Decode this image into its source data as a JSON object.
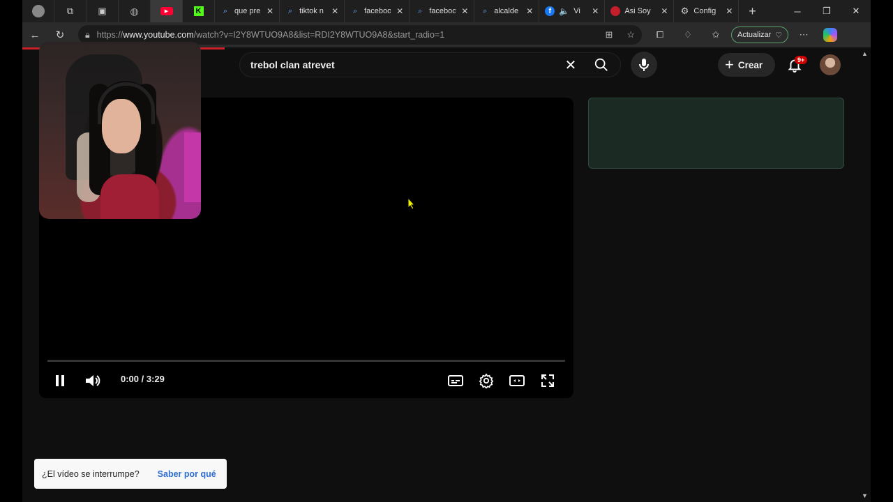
{
  "browser": {
    "tabs": [
      {
        "title": "",
        "icon": "profile-avatar-icon",
        "pinned": true
      },
      {
        "title": "",
        "icon": "workspaces-icon",
        "pinned": true
      },
      {
        "title": "",
        "icon": "tab-actions-icon",
        "pinned": true
      },
      {
        "title": "",
        "icon": "globe-icon",
        "pinned": true
      },
      {
        "title": "",
        "icon": "youtube-icon",
        "pinned": true,
        "active": true
      },
      {
        "title": "",
        "icon": "kick-icon",
        "pinned": true
      },
      {
        "title": "que pre",
        "icon": "search-icon"
      },
      {
        "title": "tiktok n",
        "icon": "search-icon"
      },
      {
        "title": "faceboo",
        "icon": "search-icon"
      },
      {
        "title": "faceboo",
        "icon": "search-icon"
      },
      {
        "title": "alcalde",
        "icon": "search-icon"
      },
      {
        "title": "Vi",
        "icon": "facebook-icon"
      },
      {
        "title": "Asi Soy",
        "icon": "red-favicon-icon"
      },
      {
        "title": "Config",
        "icon": "gear-icon"
      }
    ],
    "new_tab_symbol": "+",
    "address": {
      "prefix": "https://",
      "host": "www.youtube.com",
      "path": "/watch?v=I2Y8WTUO9A8&list=RDI2Y8WTUO9A8&start_radio=1"
    },
    "update_label": "Actualizar"
  },
  "youtube": {
    "search_query": "trebol clan atrevet",
    "create_label": "Crear",
    "notification_badge": "9+",
    "player": {
      "time_label": "0:00 / 3:29",
      "progress": 0.0
    },
    "toast": {
      "text": "¿El vídeo se interrumpe?",
      "link": "Saber por qué"
    }
  },
  "colors": {
    "accent_red": "#ff0033",
    "update_border": "#5aa06e",
    "side_panel": "#1b2b24",
    "link_blue": "#2f6fd0"
  }
}
